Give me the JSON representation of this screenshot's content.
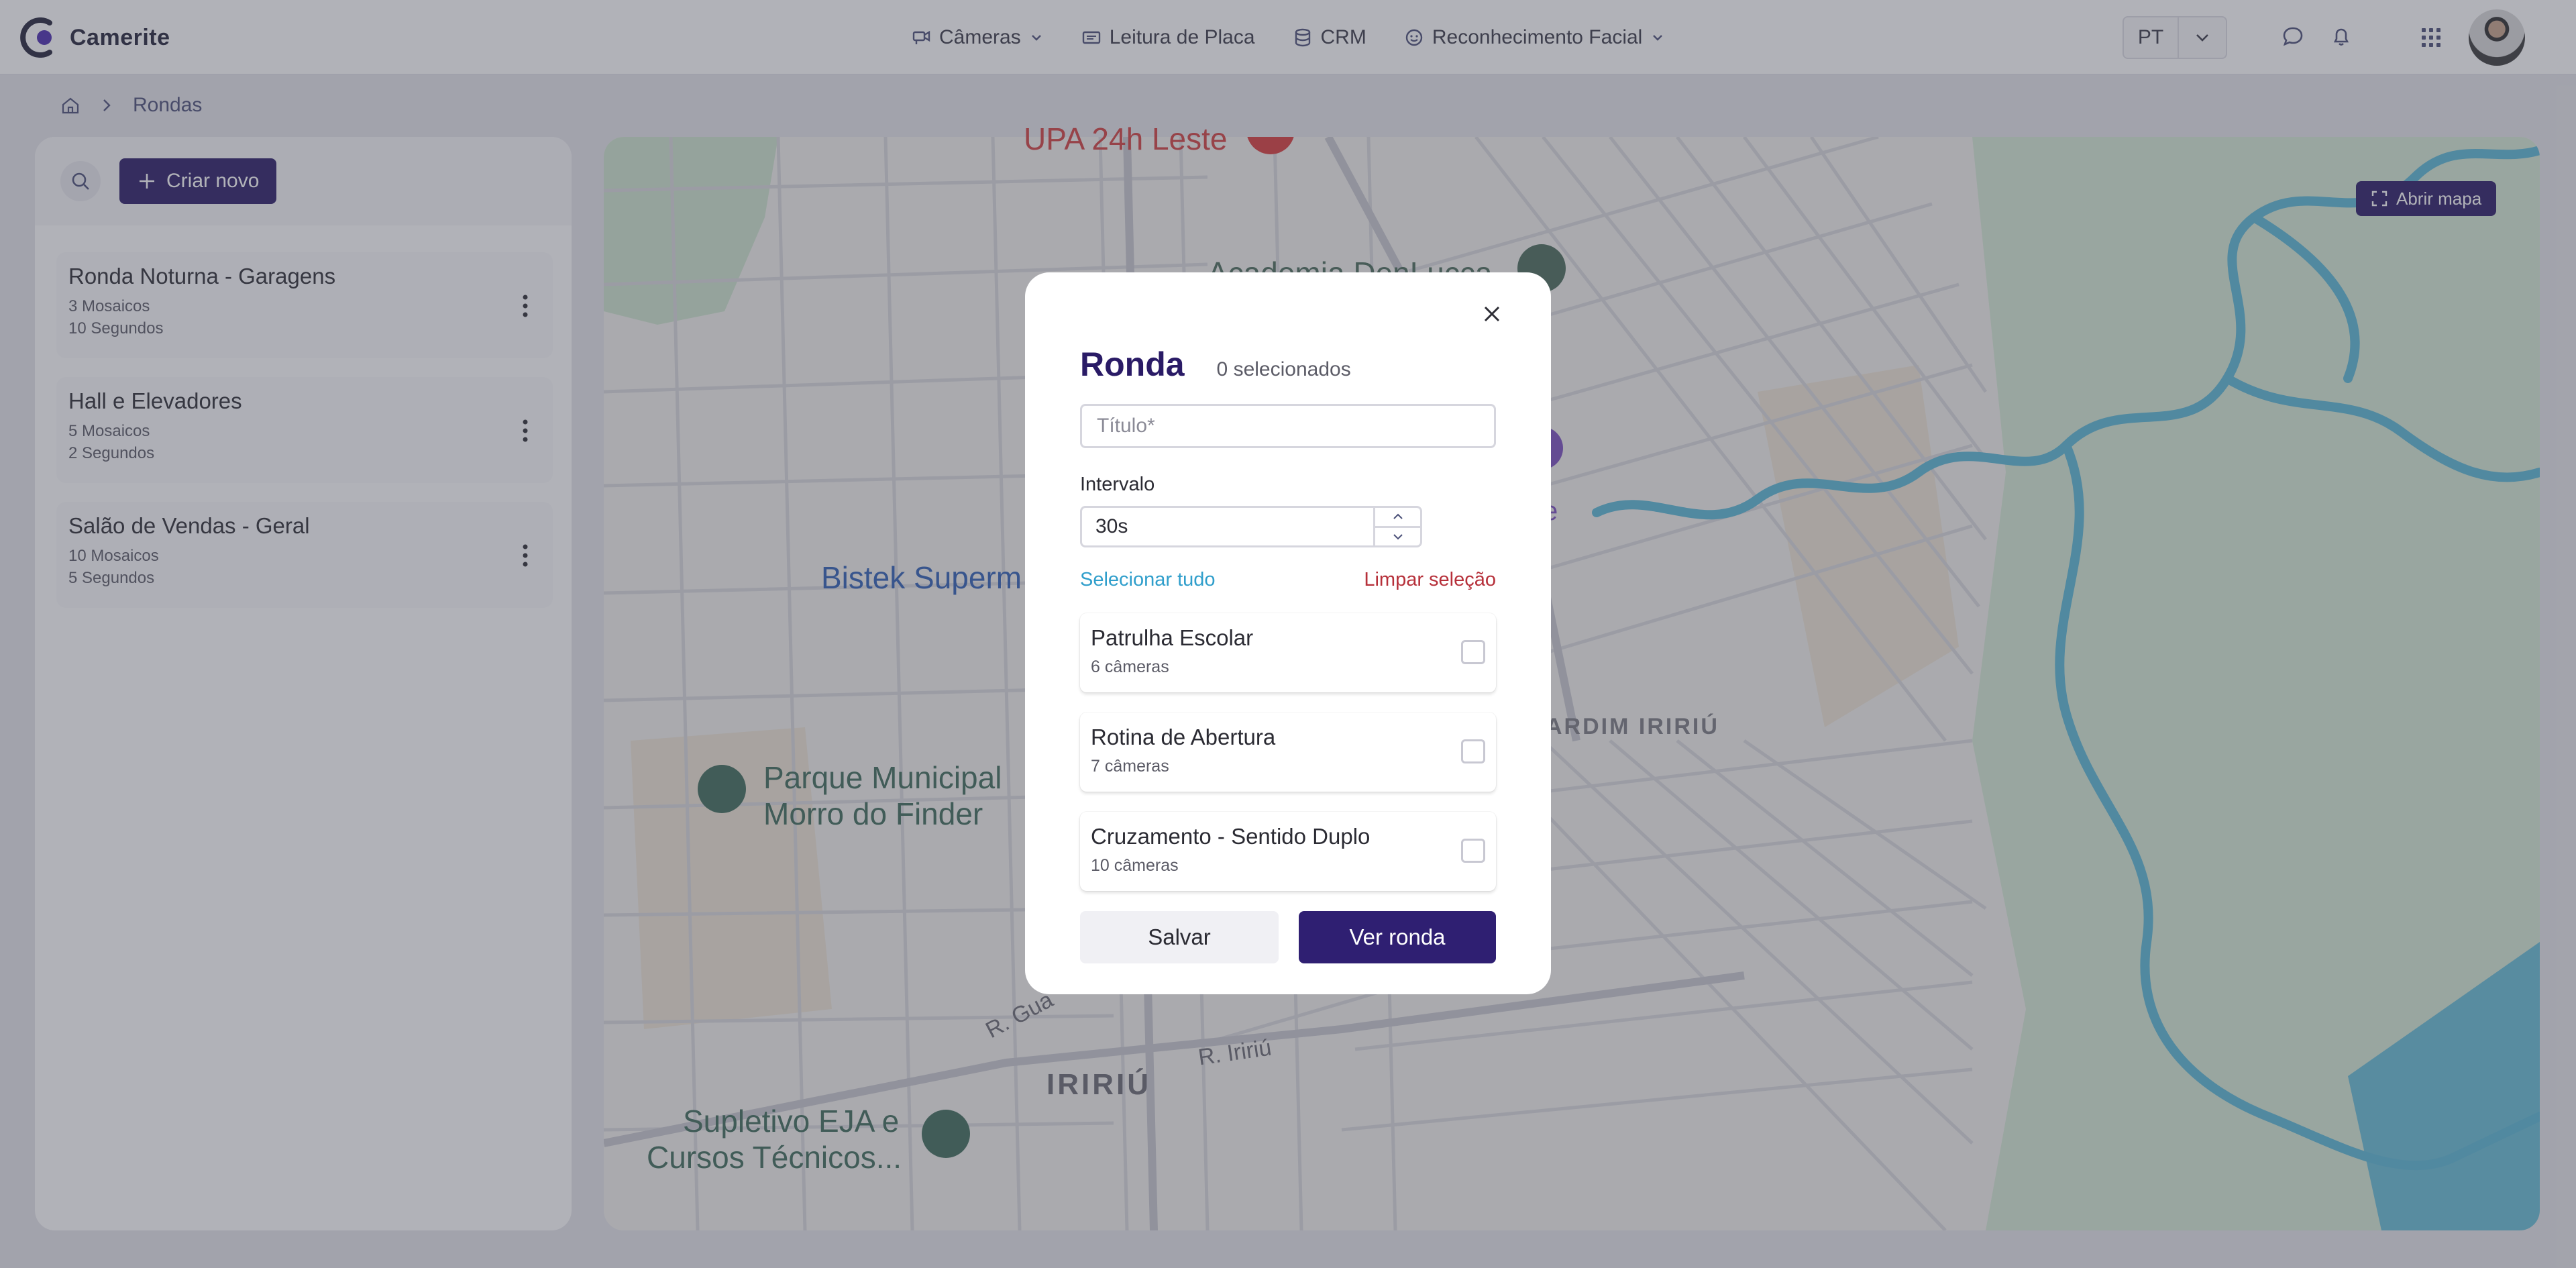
{
  "brand": {
    "name": "Camerite"
  },
  "nav": {
    "cameras": "Câmeras",
    "plates": "Leitura de Placa",
    "crm": "CRM",
    "face": "Reconhecimento Facial"
  },
  "lang": {
    "code": "PT"
  },
  "breadcrumb": {
    "current": "Rondas"
  },
  "sidebar": {
    "create_label": "Criar novo",
    "items": [
      {
        "title": "Ronda Noturna - Garagens",
        "mosaics": "3 Mosaicos",
        "seconds": "10 Segundos"
      },
      {
        "title": "Hall e Elevadores",
        "mosaics": "5 Mosaicos",
        "seconds": "2 Segundos"
      },
      {
        "title": "Salão de Vendas - Geral",
        "mosaics": "10 Mosaicos",
        "seconds": "5 Segundos"
      }
    ]
  },
  "map": {
    "open_label": "Abrir mapa",
    "labels": {
      "upa": "UPA 24h Leste",
      "academia": "Academia DenLucca",
      "bistek": "Bistek Superm",
      "parque1": "Parque Municipal",
      "parque2": "Morro do Finder",
      "jardim": "ARDIM IRIRIÚ",
      "iririu": "IRIRIÚ",
      "rua_iririu": "R. Iririú",
      "rua_gua": "R. Gua",
      "supletivo1": "Supletivo EJA e",
      "supletivo2": "Cursos Técnicos...",
      "partial_e": "e"
    }
  },
  "modal": {
    "title": "Ronda",
    "selected_count": "0 selecionados",
    "title_placeholder": "Título*",
    "interval_label": "Intervalo",
    "interval_value": "30s",
    "select_all": "Selecionar tudo",
    "clear_selection": "Limpar seleção",
    "options": [
      {
        "name": "Patrulha Escolar",
        "count": "6 câmeras"
      },
      {
        "name": "Rotina de Abertura",
        "count": "7 câmeras"
      },
      {
        "name": "Cruzamento - Sentido Duplo",
        "count": "10 câmeras"
      }
    ],
    "save_label": "Salvar",
    "view_label": "Ver ronda"
  },
  "colors": {
    "brand": "#2a1b66",
    "link": "#2f9ecb",
    "danger": "#b6303a",
    "water": "#5bb8d6"
  }
}
